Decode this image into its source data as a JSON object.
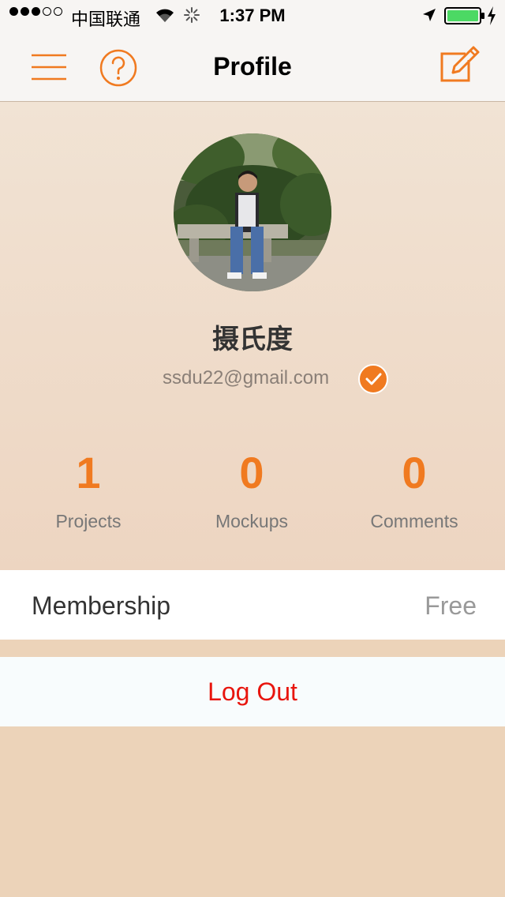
{
  "status_bar": {
    "carrier": "中国联通",
    "time": "1:37 PM",
    "signal_bars_filled": 3,
    "signal_bars_total": 5,
    "battery_color": "#4cd964"
  },
  "navbar": {
    "title": "Profile",
    "accent_color": "#f07a20",
    "icons": {
      "menu": "hamburger-menu-icon",
      "help": "question-circle-icon",
      "edit": "compose-edit-icon"
    }
  },
  "profile": {
    "name": "摄氏度",
    "email": "ssdu22@gmail.com",
    "verified_icon": "checkmark-badge-icon"
  },
  "stats": [
    {
      "value": "1",
      "label": "Projects"
    },
    {
      "value": "0",
      "label": "Mockups"
    },
    {
      "value": "0",
      "label": "Comments"
    }
  ],
  "membership": {
    "label": "Membership",
    "value": "Free"
  },
  "logout_label": "Log Out"
}
